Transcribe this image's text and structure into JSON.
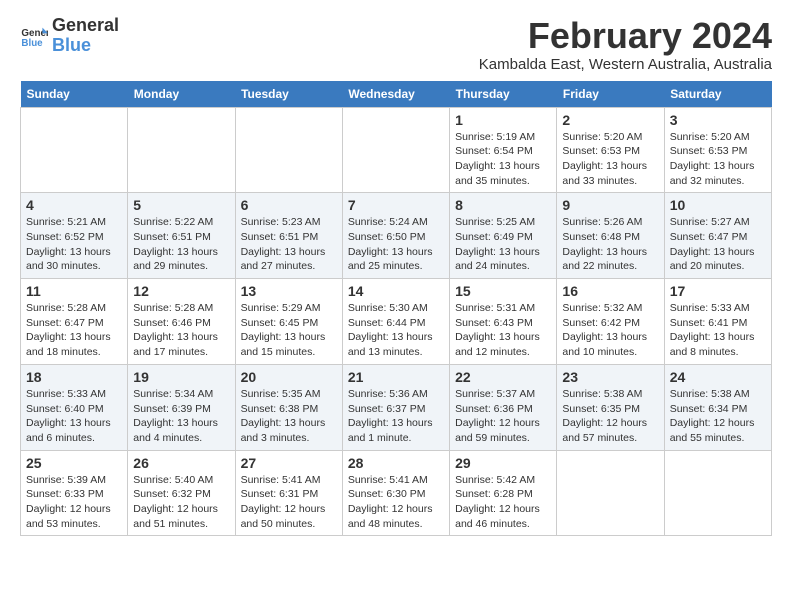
{
  "logo": {
    "text_general": "General",
    "text_blue": "Blue"
  },
  "header": {
    "title": "February 2024",
    "subtitle": "Kambalda East, Western Australia, Australia"
  },
  "weekdays": [
    "Sunday",
    "Monday",
    "Tuesday",
    "Wednesday",
    "Thursday",
    "Friday",
    "Saturday"
  ],
  "weeks": [
    [
      {
        "day": "",
        "info": ""
      },
      {
        "day": "",
        "info": ""
      },
      {
        "day": "",
        "info": ""
      },
      {
        "day": "",
        "info": ""
      },
      {
        "day": "1",
        "info": "Sunrise: 5:19 AM\nSunset: 6:54 PM\nDaylight: 13 hours\nand 35 minutes."
      },
      {
        "day": "2",
        "info": "Sunrise: 5:20 AM\nSunset: 6:53 PM\nDaylight: 13 hours\nand 33 minutes."
      },
      {
        "day": "3",
        "info": "Sunrise: 5:20 AM\nSunset: 6:53 PM\nDaylight: 13 hours\nand 32 minutes."
      }
    ],
    [
      {
        "day": "4",
        "info": "Sunrise: 5:21 AM\nSunset: 6:52 PM\nDaylight: 13 hours\nand 30 minutes."
      },
      {
        "day": "5",
        "info": "Sunrise: 5:22 AM\nSunset: 6:51 PM\nDaylight: 13 hours\nand 29 minutes."
      },
      {
        "day": "6",
        "info": "Sunrise: 5:23 AM\nSunset: 6:51 PM\nDaylight: 13 hours\nand 27 minutes."
      },
      {
        "day": "7",
        "info": "Sunrise: 5:24 AM\nSunset: 6:50 PM\nDaylight: 13 hours\nand 25 minutes."
      },
      {
        "day": "8",
        "info": "Sunrise: 5:25 AM\nSunset: 6:49 PM\nDaylight: 13 hours\nand 24 minutes."
      },
      {
        "day": "9",
        "info": "Sunrise: 5:26 AM\nSunset: 6:48 PM\nDaylight: 13 hours\nand 22 minutes."
      },
      {
        "day": "10",
        "info": "Sunrise: 5:27 AM\nSunset: 6:47 PM\nDaylight: 13 hours\nand 20 minutes."
      }
    ],
    [
      {
        "day": "11",
        "info": "Sunrise: 5:28 AM\nSunset: 6:47 PM\nDaylight: 13 hours\nand 18 minutes."
      },
      {
        "day": "12",
        "info": "Sunrise: 5:28 AM\nSunset: 6:46 PM\nDaylight: 13 hours\nand 17 minutes."
      },
      {
        "day": "13",
        "info": "Sunrise: 5:29 AM\nSunset: 6:45 PM\nDaylight: 13 hours\nand 15 minutes."
      },
      {
        "day": "14",
        "info": "Sunrise: 5:30 AM\nSunset: 6:44 PM\nDaylight: 13 hours\nand 13 minutes."
      },
      {
        "day": "15",
        "info": "Sunrise: 5:31 AM\nSunset: 6:43 PM\nDaylight: 13 hours\nand 12 minutes."
      },
      {
        "day": "16",
        "info": "Sunrise: 5:32 AM\nSunset: 6:42 PM\nDaylight: 13 hours\nand 10 minutes."
      },
      {
        "day": "17",
        "info": "Sunrise: 5:33 AM\nSunset: 6:41 PM\nDaylight: 13 hours\nand 8 minutes."
      }
    ],
    [
      {
        "day": "18",
        "info": "Sunrise: 5:33 AM\nSunset: 6:40 PM\nDaylight: 13 hours\nand 6 minutes."
      },
      {
        "day": "19",
        "info": "Sunrise: 5:34 AM\nSunset: 6:39 PM\nDaylight: 13 hours\nand 4 minutes."
      },
      {
        "day": "20",
        "info": "Sunrise: 5:35 AM\nSunset: 6:38 PM\nDaylight: 13 hours\nand 3 minutes."
      },
      {
        "day": "21",
        "info": "Sunrise: 5:36 AM\nSunset: 6:37 PM\nDaylight: 13 hours\nand 1 minute."
      },
      {
        "day": "22",
        "info": "Sunrise: 5:37 AM\nSunset: 6:36 PM\nDaylight: 12 hours\nand 59 minutes."
      },
      {
        "day": "23",
        "info": "Sunrise: 5:38 AM\nSunset: 6:35 PM\nDaylight: 12 hours\nand 57 minutes."
      },
      {
        "day": "24",
        "info": "Sunrise: 5:38 AM\nSunset: 6:34 PM\nDaylight: 12 hours\nand 55 minutes."
      }
    ],
    [
      {
        "day": "25",
        "info": "Sunrise: 5:39 AM\nSunset: 6:33 PM\nDaylight: 12 hours\nand 53 minutes."
      },
      {
        "day": "26",
        "info": "Sunrise: 5:40 AM\nSunset: 6:32 PM\nDaylight: 12 hours\nand 51 minutes."
      },
      {
        "day": "27",
        "info": "Sunrise: 5:41 AM\nSunset: 6:31 PM\nDaylight: 12 hours\nand 50 minutes."
      },
      {
        "day": "28",
        "info": "Sunrise: 5:41 AM\nSunset: 6:30 PM\nDaylight: 12 hours\nand 48 minutes."
      },
      {
        "day": "29",
        "info": "Sunrise: 5:42 AM\nSunset: 6:28 PM\nDaylight: 12 hours\nand 46 minutes."
      },
      {
        "day": "",
        "info": ""
      },
      {
        "day": "",
        "info": ""
      }
    ]
  ]
}
